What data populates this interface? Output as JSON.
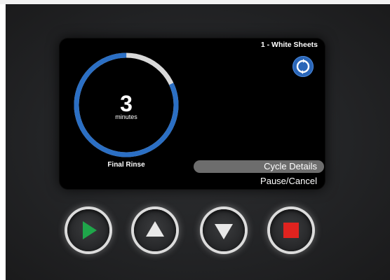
{
  "screen": {
    "program_label": "1 - White Sheets",
    "timer": {
      "value": "3",
      "unit": "minutes",
      "remaining_fraction": 0.82
    },
    "phase_label": "Final Rinse",
    "refresh_icon": "refresh-icon",
    "menu": {
      "selected": "Cycle Details",
      "items": [
        "Pause/Cancel"
      ]
    }
  },
  "buttons": [
    {
      "icon": "play-icon",
      "color": "#1fa64a"
    },
    {
      "icon": "arrow-up-icon",
      "color": "#e8e8e8"
    },
    {
      "icon": "arrow-down-icon",
      "color": "#e8e8e8"
    },
    {
      "icon": "stop-icon",
      "color": "#e0231f"
    }
  ],
  "colors": {
    "ring_progress": "#2b6fc4",
    "ring_track": "#d9d9d9",
    "menu_highlight": "#6d6d6d"
  }
}
